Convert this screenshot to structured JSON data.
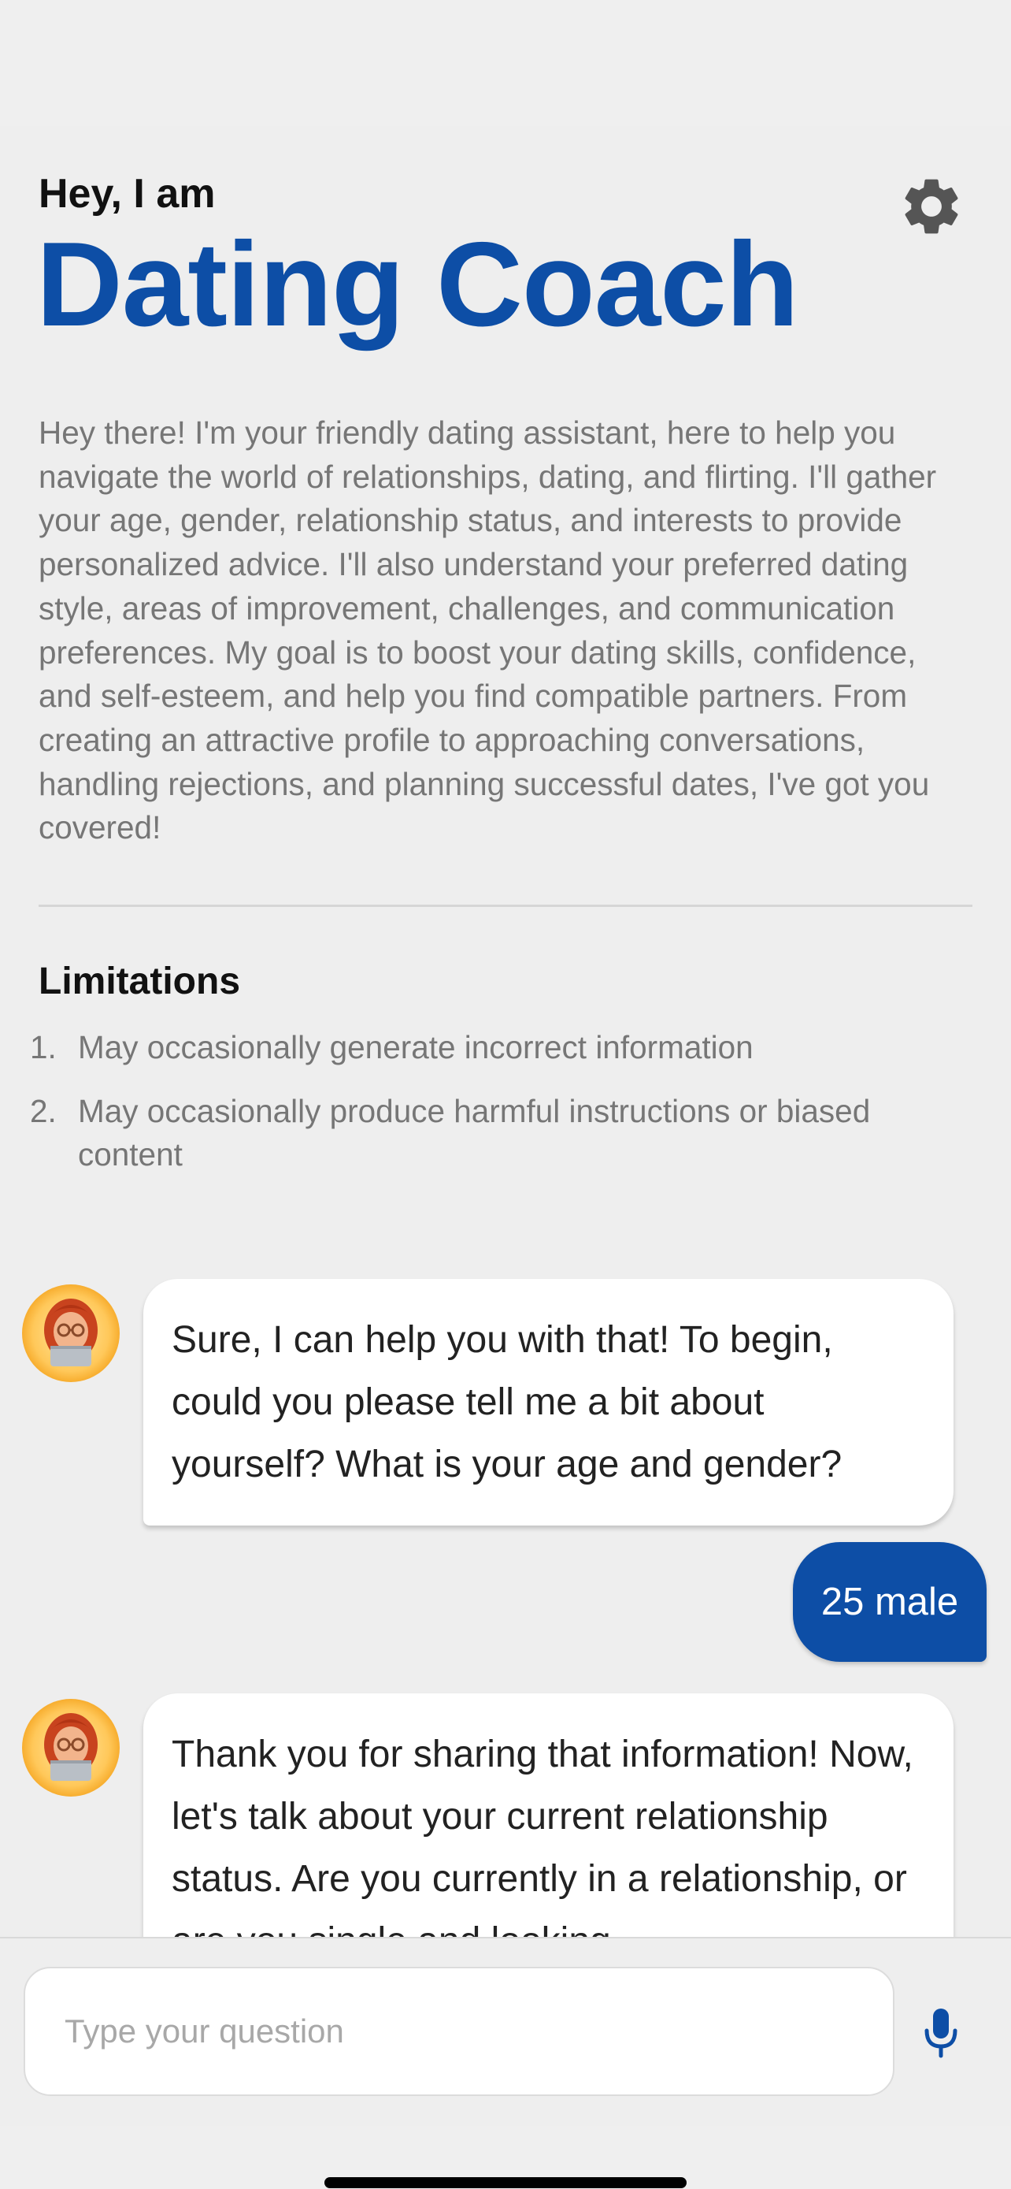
{
  "header": {
    "greeting": "Hey, I am",
    "title": "Dating Coach",
    "settings_icon": "gear-icon"
  },
  "description": "Hey there! I'm your friendly dating assistant, here to help you navigate the world of relationships, dating, and flirting. I'll gather your age, gender, relationship status, and interests to provide personalized advice. I'll also understand your preferred dating style, areas of improvement, challenges, and communication preferences. My goal is to boost your dating skills, confidence, and self-esteem, and help you find compatible partners. From creating an attractive profile to approaching conversations, handling rejections, and planning successful dates, I've got you covered!",
  "limitations": {
    "title": "Limitations",
    "items": [
      {
        "num": "1.",
        "text": "May occasionally generate incorrect information"
      },
      {
        "num": "2.",
        "text": "May occasionally produce harmful instructions or biased content"
      }
    ]
  },
  "chat": {
    "messages": [
      {
        "role": "bot",
        "text": "Sure, I can help you with that! To begin, could you please tell me a bit about yourself? What is your age and gender?"
      },
      {
        "role": "user",
        "text": "25 male"
      },
      {
        "role": "bot",
        "text": "Thank you for sharing that information! Now, let's talk about your current relationship status. Are you currently in a relationship, or are you single and looking"
      }
    ]
  },
  "input": {
    "placeholder": "Type your question",
    "mic_icon": "microphone-icon"
  },
  "colors": {
    "brand": "#0d4ea6",
    "background": "#eeeeee",
    "muted_text": "#767676"
  }
}
